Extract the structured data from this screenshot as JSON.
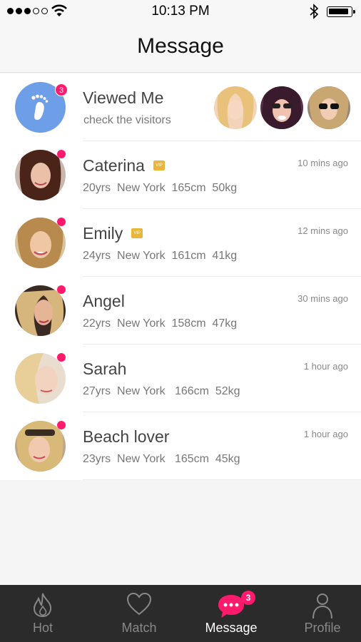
{
  "status_bar": {
    "time": "10:13 PM",
    "signal_icon": "signal-dots-icon",
    "wifi_icon": "wifi-icon",
    "bluetooth_icon": "bluetooth-icon",
    "battery_icon": "battery-icon",
    "battery_level": 0.8
  },
  "header": {
    "title": "Message"
  },
  "viewed_me": {
    "title": "Viewed Me",
    "subtitle": "check the visitors",
    "badge": "3",
    "icon": "footprint-icon",
    "accent": "#6e9ee8"
  },
  "messages": [
    {
      "name": "Caterina",
      "vip": true,
      "vip_label": "VIP",
      "details": "20yrs  New York  165cm  50kg",
      "time": "10 mins ago"
    },
    {
      "name": "Emily",
      "vip": true,
      "vip_label": "VIP",
      "details": "24yrs  New York  161cm  41kg",
      "time": "12 mins ago"
    },
    {
      "name": "Angel",
      "vip": false,
      "details": "22yrs  New York  158cm  47kg",
      "time": "30 mins ago"
    },
    {
      "name": "Sarah",
      "vip": false,
      "details": "27yrs  New York   166cm  52kg",
      "time": "1 hour ago"
    },
    {
      "name": "Beach lover",
      "vip": false,
      "details": "23yrs  New York   165cm  45kg",
      "time": "1 hour ago"
    }
  ],
  "tabs": [
    {
      "label": "Hot",
      "icon": "flame-icon",
      "active": false
    },
    {
      "label": "Match",
      "icon": "heart-icon",
      "active": false
    },
    {
      "label": "Message",
      "icon": "chat-bubble-icon",
      "active": true,
      "badge": "3"
    },
    {
      "label": "Profile",
      "icon": "person-icon",
      "active": false
    }
  ],
  "colors": {
    "accent_pink": "#ff1a6c",
    "vip_gold": "#e8b73a",
    "tabbar_bg": "#2b2b2b"
  }
}
